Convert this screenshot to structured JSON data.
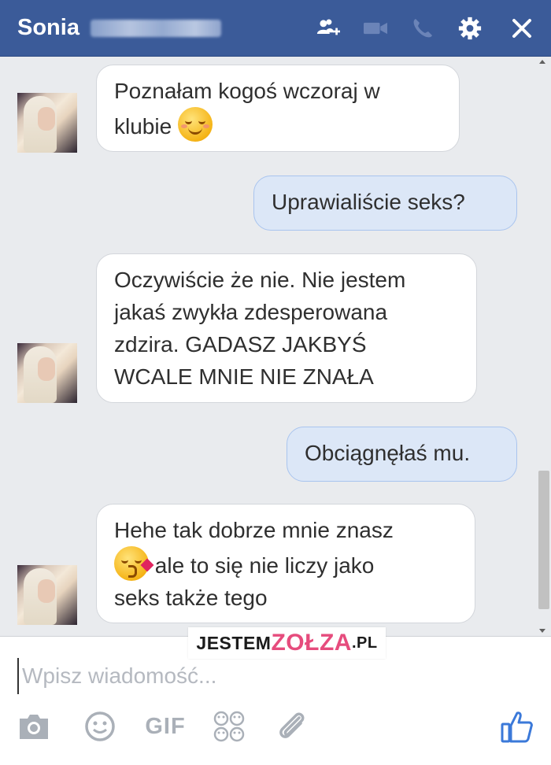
{
  "header": {
    "contact_name": "Sonia",
    "bg_color": "#3b5b99",
    "icons": [
      "add-person-icon",
      "video-call-icon",
      "phone-icon",
      "gear-icon",
      "close-icon"
    ]
  },
  "messages": [
    {
      "from": "contact",
      "text_1": "Poznałam kogoś wczoraj w",
      "text_2": "klubie",
      "emoji": "smiling-face-icon"
    },
    {
      "from": "me",
      "text": "Uprawialiście seks?"
    },
    {
      "from": "contact",
      "lines": [
        "Oczywiście że nie. Nie jestem",
        "jakaś zwykła zdesperowana",
        "zdzira. GADASZ JAKBYŚ",
        "WCALE MNIE NIE ZNAŁA"
      ]
    },
    {
      "from": "me",
      "text": "Obciągnęłaś mu."
    },
    {
      "from": "contact",
      "line_1": "Hehe tak dobrze mnie znasz",
      "line_2": "ale to się nie liczy jako",
      "line_3": "seks także tego",
      "emoji": "kissing-face-icon"
    }
  ],
  "watermark": {
    "part_1": "JESTEM",
    "part_2": "ZOŁZA",
    "part_3": ".PL"
  },
  "composer": {
    "placeholder": "Wpisz wiadomość...",
    "gif_label": "GIF",
    "icons": [
      "camera-icon",
      "emoji-icon",
      "gif-icon",
      "stickers-icon",
      "attachment-icon",
      "like-icon"
    ],
    "like_color": "#3b79d9"
  }
}
